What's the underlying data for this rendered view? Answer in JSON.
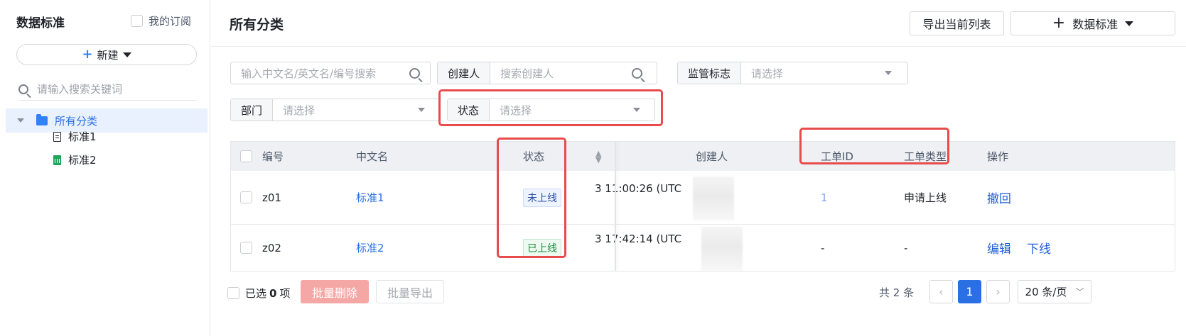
{
  "sidebar": {
    "title": "数据标准",
    "my_subscription": "我的订阅",
    "new_button": "新建",
    "search_placeholder": "请输入搜索关键词",
    "tree": {
      "root": "所有分类",
      "items": [
        "标准1",
        "标准2"
      ]
    }
  },
  "header": {
    "title": "所有分类",
    "export_list": "导出当前列表",
    "add_standard": "数据标准"
  },
  "filters": {
    "name_placeholder": "输入中文名/英文名/编号搜索",
    "creator_label": "创建人",
    "creator_placeholder": "搜索创建人",
    "supervision_label": "监管标志",
    "supervision_placeholder": "请选择",
    "department_label": "部门",
    "department_placeholder": "请选择",
    "status_label": "状态",
    "status_placeholder": "请选择"
  },
  "table": {
    "headers": {
      "code": "编号",
      "name": "中文名",
      "status": "状态",
      "creator": "创建人",
      "ticket_id": "工单ID",
      "ticket_type": "工单类型",
      "actions": "操作"
    },
    "rows": [
      {
        "code": "z01",
        "name": "标准1",
        "status": "未上线",
        "time": "3 11:00:26 (UTC",
        "ticket_id": "1",
        "ticket_type": "申请上线",
        "actions": [
          "撤回"
        ]
      },
      {
        "code": "z02",
        "name": "标准2",
        "status": "已上线",
        "time": "3 17:42:14 (UTC",
        "ticket_id": "-",
        "ticket_type": "-",
        "actions": [
          "编辑",
          "下线"
        ]
      }
    ]
  },
  "footer": {
    "selected_prefix": "已选",
    "selected_count": "0",
    "selected_suffix": "项",
    "batch_delete": "批量删除",
    "batch_export": "批量导出",
    "total": "共 2 条",
    "prev": "‹",
    "current_page": "1",
    "next": "›",
    "page_size": "20 条/页"
  },
  "colors": {
    "accent": "#2b6fe5",
    "highlight": "#e84b4b",
    "danger_button": "#f4a7a4"
  }
}
